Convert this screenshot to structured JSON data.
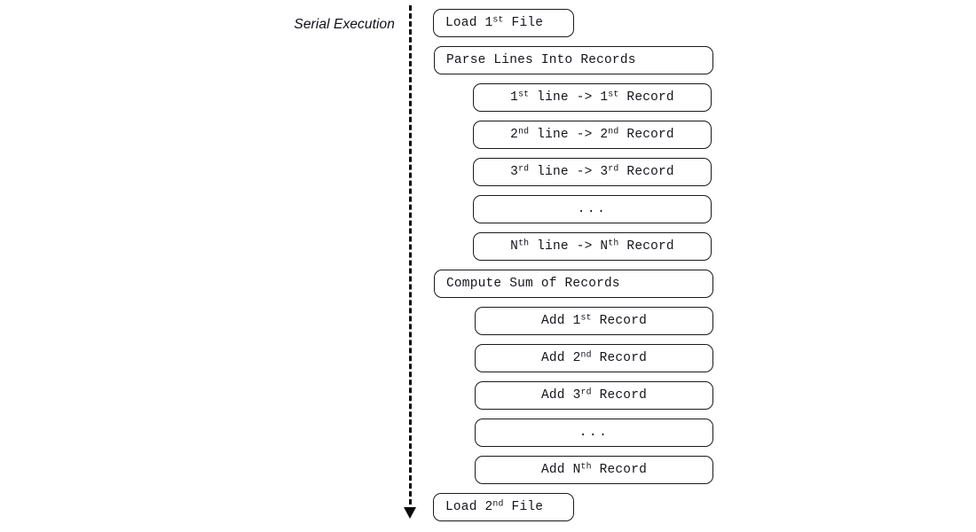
{
  "diagram": {
    "title": "Serial Execution",
    "phase_label": "Serial Execution",
    "axis": {
      "name": "serial-execution-timeline",
      "style": "dashed",
      "direction": "downward",
      "color": "#0b0b0b"
    },
    "colors": {
      "box_border": "#1a1a1a",
      "box_fill": "#ffffff",
      "text": "#14141c",
      "axis": "#0b0b0b",
      "background": "#ffffff"
    },
    "steps": [
      {
        "id": "load-1st-file",
        "level": 0,
        "text_html": "Load 1<sup>st</sup> File",
        "text": "Load 1st File"
      },
      {
        "id": "parse-lines",
        "level": 0,
        "text_html": "Parse Lines Into Records",
        "text": "Parse Lines Into Records"
      },
      {
        "id": "line-1",
        "level": 1,
        "text_html": "1<sup>st</sup> line -&gt; 1<sup>st</sup> Record",
        "text": "1st line -> 1st Record"
      },
      {
        "id": "line-2",
        "level": 1,
        "text_html": "2<sup>nd</sup> line -&gt; 2<sup>nd</sup> Record",
        "text": "2nd line -> 2nd Record"
      },
      {
        "id": "line-3",
        "level": 1,
        "text_html": "3<sup>rd</sup> line -&gt; 3<sup>rd</sup> Record",
        "text": "3rd line -> 3rd Record"
      },
      {
        "id": "line-ellipsis",
        "level": 1,
        "text_html": "...",
        "text": "..."
      },
      {
        "id": "line-n",
        "level": 1,
        "text_html": "N<sup>th</sup> line -&gt; N<sup>th</sup> Record",
        "text": "Nth line -> Nth Record"
      },
      {
        "id": "compute-sum",
        "level": 0,
        "text_html": "Compute Sum of Records",
        "text": "Compute Sum of Records"
      },
      {
        "id": "add-1",
        "level": 1,
        "text_html": "Add 1<sup>st</sup> Record",
        "text": "Add 1st Record"
      },
      {
        "id": "add-2",
        "level": 1,
        "text_html": "Add 2<sup>nd</sup> Record",
        "text": "Add 2nd Record"
      },
      {
        "id": "add-3",
        "level": 1,
        "text_html": "Add 3<sup>rd</sup> Record",
        "text": "Add 3rd Record"
      },
      {
        "id": "add-ellipsis",
        "level": 1,
        "text_html": "...",
        "text": "..."
      },
      {
        "id": "add-n",
        "level": 1,
        "text_html": "Add N<sup>th</sup> Record",
        "text": "Add Nth Record"
      },
      {
        "id": "load-2nd-file",
        "level": 0,
        "text_html": "Load 2<sup>nd</sup> File",
        "text": "Load 2nd File"
      }
    ]
  }
}
